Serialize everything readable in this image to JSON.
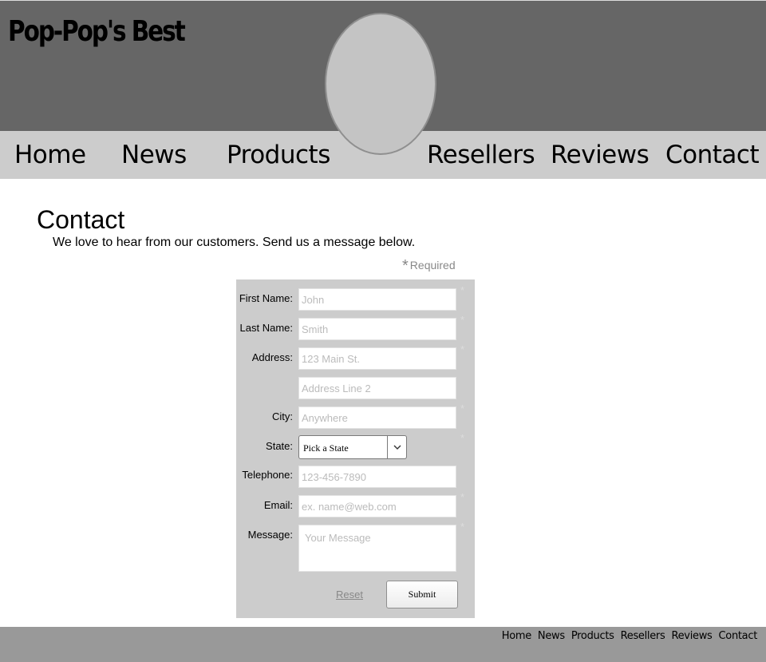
{
  "site": {
    "logo": "Pop-Pop's Best"
  },
  "nav": {
    "home": "Home",
    "news": "News",
    "products": "Products",
    "resellers": "Resellers",
    "reviews": "Reviews",
    "contact": "Contact"
  },
  "page": {
    "title": "Contact",
    "intro": "We love to hear from our customers. Send us a message below."
  },
  "form": {
    "required_star": "*",
    "required_label": "Required",
    "first_name": {
      "label": "First Name:",
      "placeholder": "John"
    },
    "last_name": {
      "label": "Last Name:",
      "placeholder": "Smith"
    },
    "address": {
      "label": "Address:",
      "placeholder": "123 Main St.",
      "placeholder2": "Address Line 2"
    },
    "city": {
      "label": "City:",
      "placeholder": "Anywhere"
    },
    "state": {
      "label": "State:",
      "selected": "Pick a State"
    },
    "telephone": {
      "label": "Telephone:",
      "placeholder": "123-456-7890"
    },
    "email": {
      "label": "Email:",
      "placeholder": "ex. name@web.com"
    },
    "message": {
      "label": "Message:",
      "placeholder": "Your Message"
    },
    "reset_label": "Reset",
    "submit_label": "Submit"
  },
  "footer": {
    "home": "Home",
    "news": "News",
    "products": "Products",
    "resellers": "Resellers",
    "reviews": "Reviews",
    "contact": "Contact"
  },
  "colors": {
    "header_bg": "#666666",
    "nav_bg": "#cccccc",
    "form_bg": "#cccccc",
    "footer_bg": "#999999",
    "placeholder_text": "#bbbbbb"
  }
}
